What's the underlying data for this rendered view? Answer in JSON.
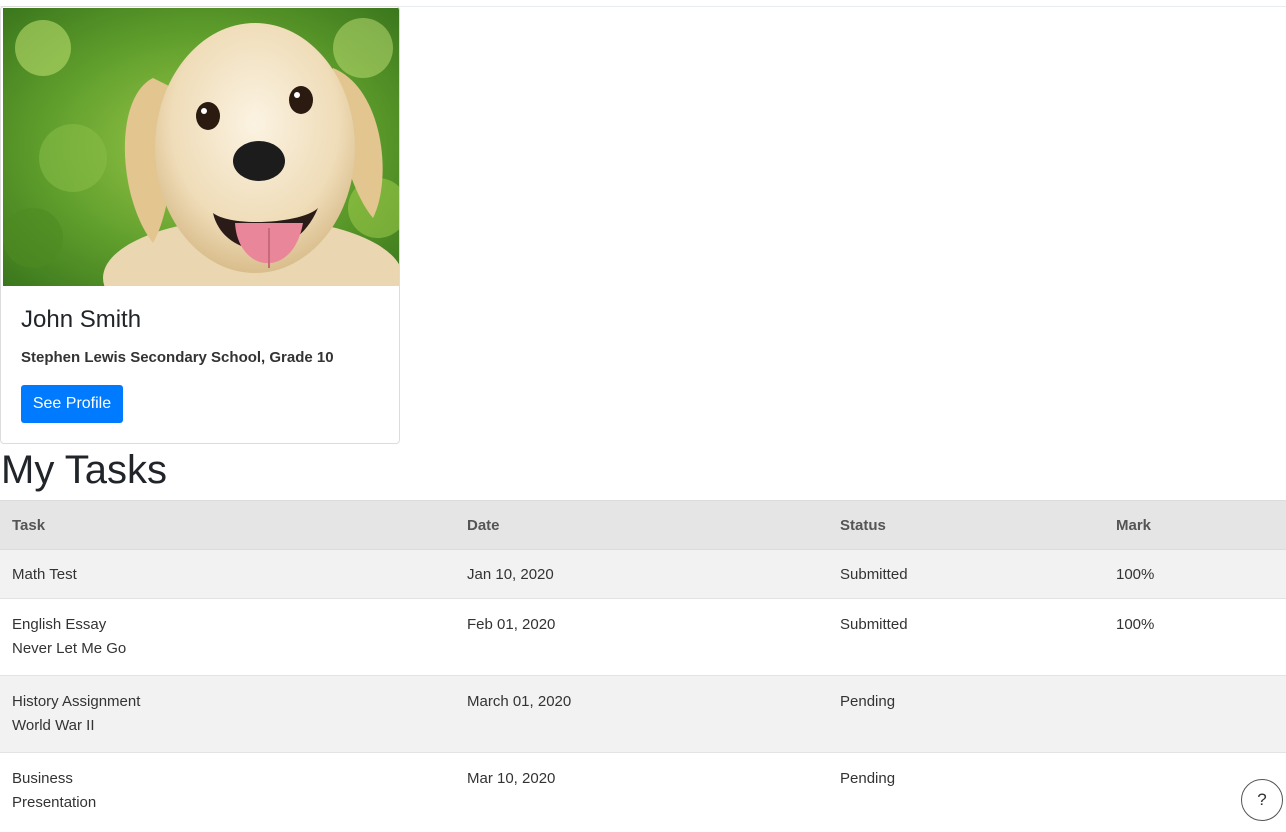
{
  "profile": {
    "photo": "puppy-photo",
    "name": "John Smith",
    "school": "Stephen Lewis Secondary School, Grade 10",
    "button_label": "See Profile"
  },
  "tasks": {
    "heading": "My Tasks",
    "columns": [
      "Task",
      "Date",
      "Status",
      "Mark"
    ],
    "rows": [
      {
        "task": [
          "Math Test"
        ],
        "date": "Jan 10, 2020",
        "status": "Submitted",
        "mark": "100%"
      },
      {
        "task": [
          "English Essay",
          "Never Let Me Go"
        ],
        "date": "Feb 01, 2020",
        "status": "Submitted",
        "mark": "100%"
      },
      {
        "task": [
          "History Assignment",
          "World War II"
        ],
        "date": "March 01, 2020",
        "status": "Pending",
        "mark": ""
      },
      {
        "task": [
          "Business",
          "Presentation"
        ],
        "date": "Mar 10, 2020",
        "status": "Pending",
        "mark": ""
      }
    ]
  },
  "help": {
    "label": "?",
    "icon": "help-icon"
  },
  "colors": {
    "primary_button": "#007bff",
    "header_row": "#e5e5e5",
    "striped_row": "#f2f2f2"
  }
}
